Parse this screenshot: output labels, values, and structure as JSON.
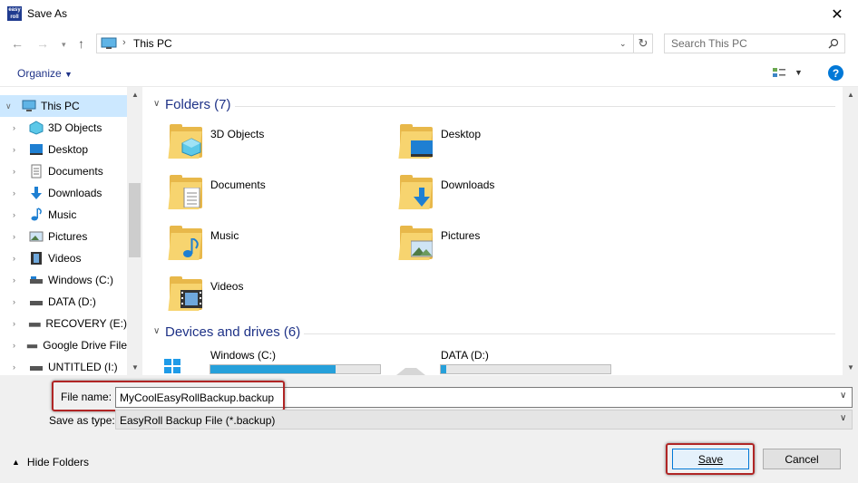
{
  "window": {
    "title": "Save As",
    "app_icon_text": "easy roll",
    "close_glyph": "✕"
  },
  "address": {
    "location": "This PC",
    "separator": "›",
    "search_placeholder": "Search This PC"
  },
  "toolbar": {
    "organize_label": "Organize"
  },
  "nav": {
    "items": [
      {
        "label": "This PC",
        "icon": "pc-icon",
        "selected": true
      },
      {
        "label": "3D Objects",
        "icon": "3d-objects-icon"
      },
      {
        "label": "Desktop",
        "icon": "desktop-icon"
      },
      {
        "label": "Documents",
        "icon": "documents-icon"
      },
      {
        "label": "Downloads",
        "icon": "downloads-icon"
      },
      {
        "label": "Music",
        "icon": "music-icon"
      },
      {
        "label": "Pictures",
        "icon": "pictures-icon"
      },
      {
        "label": "Videos",
        "icon": "videos-icon"
      },
      {
        "label": "Windows (C:)",
        "icon": "drive-icon"
      },
      {
        "label": "DATA (D:)",
        "icon": "drive-icon"
      },
      {
        "label": "RECOVERY (E:)",
        "icon": "drive-icon"
      },
      {
        "label": "Google Drive File",
        "icon": "drive-icon"
      },
      {
        "label": "UNTITLED (I:)",
        "icon": "drive-icon"
      }
    ]
  },
  "content": {
    "folders_header": "Folders (7)",
    "folders": [
      {
        "name": "3D Objects",
        "icon": "3d-objects-icon"
      },
      {
        "name": "Desktop",
        "icon": "desktop-icon"
      },
      {
        "name": "Documents",
        "icon": "documents-icon"
      },
      {
        "name": "Downloads",
        "icon": "downloads-icon"
      },
      {
        "name": "Music",
        "icon": "music-icon"
      },
      {
        "name": "Pictures",
        "icon": "pictures-icon"
      },
      {
        "name": "Videos",
        "icon": "videos-icon"
      }
    ],
    "drives_header": "Devices and drives (6)",
    "drives": [
      {
        "name": "Windows (C:)",
        "used_fraction": 0.74
      },
      {
        "name": "DATA (D:)",
        "used_fraction": 0.03
      }
    ]
  },
  "form": {
    "file_name_label": "File name:",
    "file_name_value": "MyCoolEasyRollBackup.backup",
    "save_type_label": "Save as type:",
    "save_type_value": "EasyRoll Backup File  (*.backup)"
  },
  "footer": {
    "hide_folders_label": "Hide Folders",
    "save_label": "Save",
    "cancel_label": "Cancel"
  },
  "colors": {
    "accent": "#0078d7",
    "highlight_box": "#b02525",
    "group_title": "#1e3287",
    "drive_fill": "#26a0da"
  }
}
